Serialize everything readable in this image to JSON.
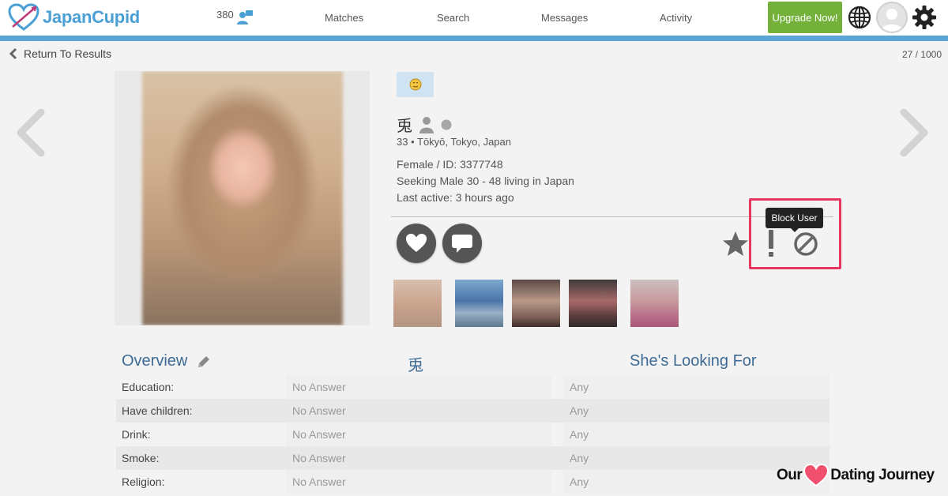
{
  "header": {
    "logo_text": "JapanCupid",
    "notification_count": "380",
    "nav": [
      "Matches",
      "Search",
      "Messages",
      "Activity"
    ],
    "upgrade_label": "Upgrade Now!",
    "accent_color": "#4a9fd5",
    "upgrade_color": "#73b13a"
  },
  "subbar": {
    "back_label": "Return To Results",
    "counter": "27 / 1000"
  },
  "profile": {
    "username": "兎",
    "location": "33 • Tōkyō, Tokyo, Japan",
    "gender_id": "Female / ID: 3377748",
    "seeking": "Seeking Male 30 - 48 living in Japan",
    "last_active": "Last active: 3 hours ago",
    "tooltip": "Block User",
    "photo_count": 5
  },
  "table": {
    "overview_heading": "Overview",
    "her_heading": "兎",
    "looking_heading": "She's Looking For",
    "rows": [
      {
        "label": "Education:",
        "her": "No Answer",
        "seeking": "Any"
      },
      {
        "label": "Have children:",
        "her": "No Answer",
        "seeking": "Any"
      },
      {
        "label": "Drink:",
        "her": "No Answer",
        "seeking": "Any"
      },
      {
        "label": "Smoke:",
        "her": "No Answer",
        "seeking": "Any"
      },
      {
        "label": "Religion:",
        "her": "No Answer",
        "seeking": "Any"
      }
    ]
  },
  "watermark": {
    "left": "Our",
    "right": "Dating Journey"
  }
}
